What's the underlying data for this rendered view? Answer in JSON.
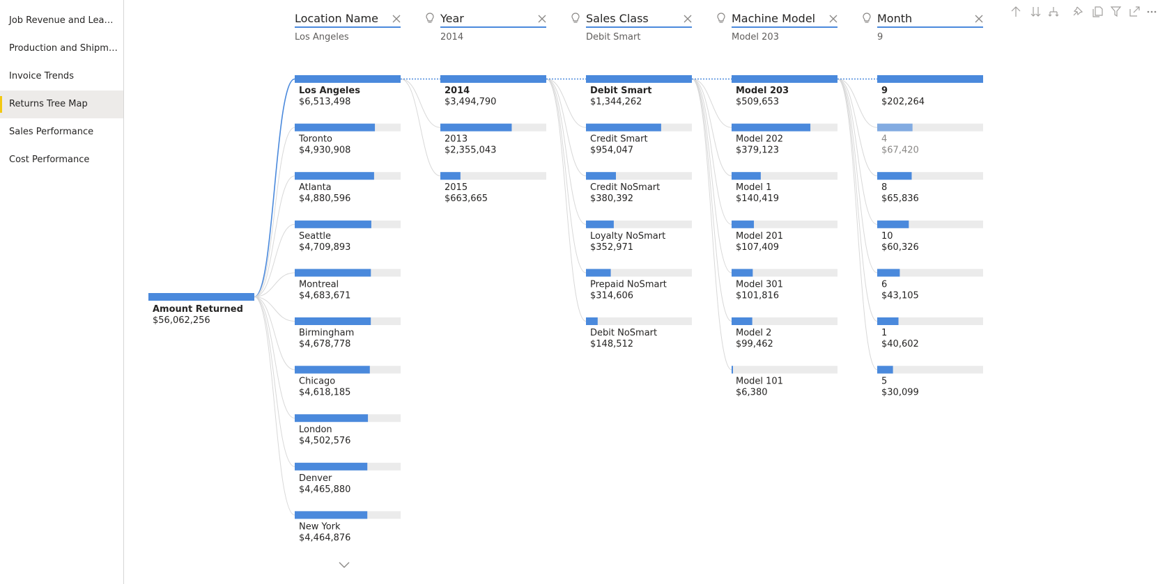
{
  "sidebar": {
    "items": [
      {
        "label": "Job Revenue and Lead ...",
        "active": false
      },
      {
        "label": "Production and Shipme...",
        "active": false
      },
      {
        "label": "Invoice Trends",
        "active": false
      },
      {
        "label": "Returns Tree Map",
        "active": true
      },
      {
        "label": "Sales Performance",
        "active": false
      },
      {
        "label": "Cost Performance",
        "active": false
      }
    ]
  },
  "toolbar": {
    "icons": [
      "arrow-up-icon",
      "double-arrow-down-icon",
      "expand-hierarchy-icon",
      "pin-icon",
      "copy-icon",
      "filter-icon",
      "focus-mode-icon",
      "more-options-icon"
    ]
  },
  "colors": {
    "accent": "#4a89dc",
    "track": "#ebebeb",
    "connector": "#d8d8d8",
    "nav_active_marker": "#f2c811"
  },
  "chart_data": {
    "type": "decomposition_tree",
    "root": {
      "label": "Amount Returned",
      "value_text": "$56,062,256",
      "value": 56062256
    },
    "levels": [
      {
        "header": "Location Name",
        "selected": "Los Angeles",
        "ai_split": false,
        "nodes": [
          {
            "label": "Los Angeles",
            "value_text": "$6,513,498",
            "value": 6513498
          },
          {
            "label": "Toronto",
            "value_text": "$4,930,908",
            "value": 4930908
          },
          {
            "label": "Atlanta",
            "value_text": "$4,880,596",
            "value": 4880596
          },
          {
            "label": "Seattle",
            "value_text": "$4,709,893",
            "value": 4709893
          },
          {
            "label": "Montreal",
            "value_text": "$4,683,671",
            "value": 4683671
          },
          {
            "label": "Birmingham",
            "value_text": "$4,678,778",
            "value": 4678778
          },
          {
            "label": "Chicago",
            "value_text": "$4,618,185",
            "value": 4618185
          },
          {
            "label": "London",
            "value_text": "$4,502,576",
            "value": 4502576
          },
          {
            "label": "Denver",
            "value_text": "$4,465,880",
            "value": 4465880
          },
          {
            "label": "New York",
            "value_text": "$4,464,876",
            "value": 4464876
          }
        ]
      },
      {
        "header": "Year",
        "selected": "2014",
        "ai_split": true,
        "nodes": [
          {
            "label": "2014",
            "value_text": "$3,494,790",
            "value": 3494790
          },
          {
            "label": "2013",
            "value_text": "$2,355,043",
            "value": 2355043
          },
          {
            "label": "2015",
            "value_text": "$663,665",
            "value": 663665
          }
        ]
      },
      {
        "header": "Sales Class",
        "selected": "Debit Smart",
        "ai_split": true,
        "nodes": [
          {
            "label": "Debit Smart",
            "value_text": "$1,344,262",
            "value": 1344262
          },
          {
            "label": "Credit Smart",
            "value_text": "$954,047",
            "value": 954047
          },
          {
            "label": "Credit NoSmart",
            "value_text": "$380,392",
            "value": 380392
          },
          {
            "label": "Loyalty NoSmart",
            "value_text": "$352,971",
            "value": 352971
          },
          {
            "label": "Prepaid NoSmart",
            "value_text": "$314,606",
            "value": 314606
          },
          {
            "label": "Debit NoSmart",
            "value_text": "$148,512",
            "value": 148512
          }
        ]
      },
      {
        "header": "Machine Model",
        "selected": "Model 203",
        "ai_split": true,
        "nodes": [
          {
            "label": "Model 203",
            "value_text": "$509,653",
            "value": 509653
          },
          {
            "label": "Model 202",
            "value_text": "$379,123",
            "value": 379123
          },
          {
            "label": "Model 1",
            "value_text": "$140,419",
            "value": 140419
          },
          {
            "label": "Model 201",
            "value_text": "$107,409",
            "value": 107409
          },
          {
            "label": "Model 301",
            "value_text": "$101,816",
            "value": 101816
          },
          {
            "label": "Model 2",
            "value_text": "$99,462",
            "value": 99462
          },
          {
            "label": "Model 101",
            "value_text": "$6,380",
            "value": 6380
          }
        ]
      },
      {
        "header": "Month",
        "selected": "9",
        "ai_split": true,
        "nodes": [
          {
            "label": "9",
            "value_text": "$202,264",
            "value": 202264
          },
          {
            "label": "4",
            "value_text": "$67,420",
            "value": 67420,
            "dimmed": true
          },
          {
            "label": "8",
            "value_text": "$65,836",
            "value": 65836
          },
          {
            "label": "10",
            "value_text": "$60,326",
            "value": 60326
          },
          {
            "label": "6",
            "value_text": "$43,105",
            "value": 43105
          },
          {
            "label": "1",
            "value_text": "$40,602",
            "value": 40602
          },
          {
            "label": "5",
            "value_text": "$30,099",
            "value": 30099
          }
        ]
      }
    ]
  }
}
